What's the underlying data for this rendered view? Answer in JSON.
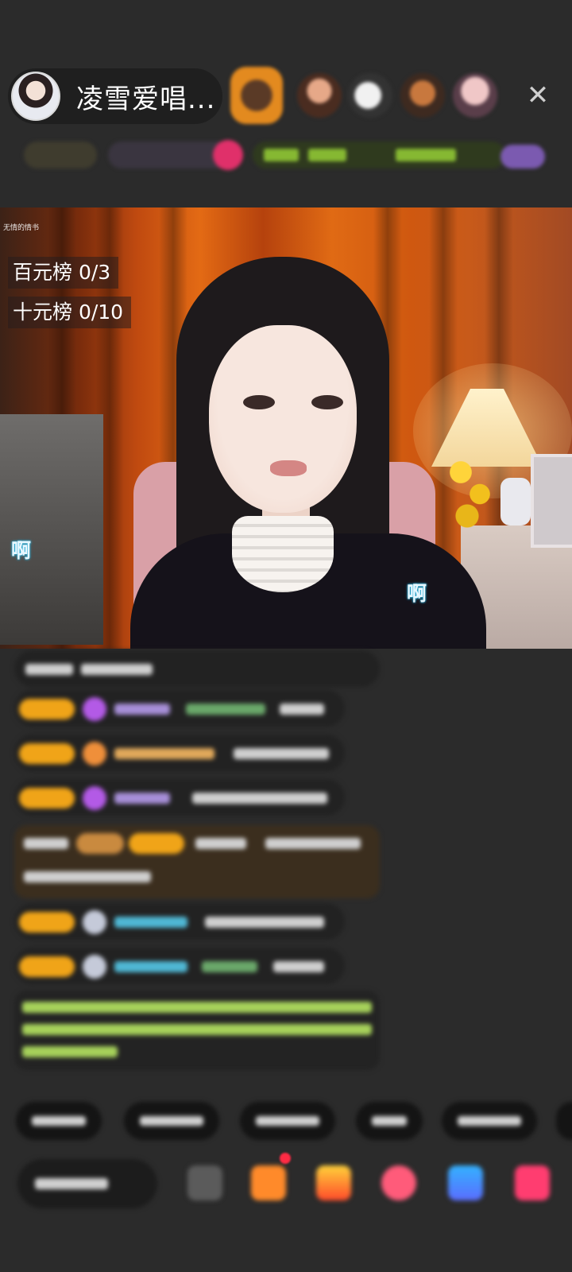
{
  "header": {
    "host_name": "凌雪爱唱...",
    "close_icon": "✕"
  },
  "video": {
    "stream_tag": "无情的情书",
    "board_hundred": "百元榜  0/3",
    "board_ten": "十元榜  0/10",
    "overlay_char_left": "啊",
    "overlay_char_right": "啊"
  },
  "colors": {
    "background": "#2b2b2b",
    "badge": "#f0a418",
    "effect_text": "#2bb5e0"
  }
}
